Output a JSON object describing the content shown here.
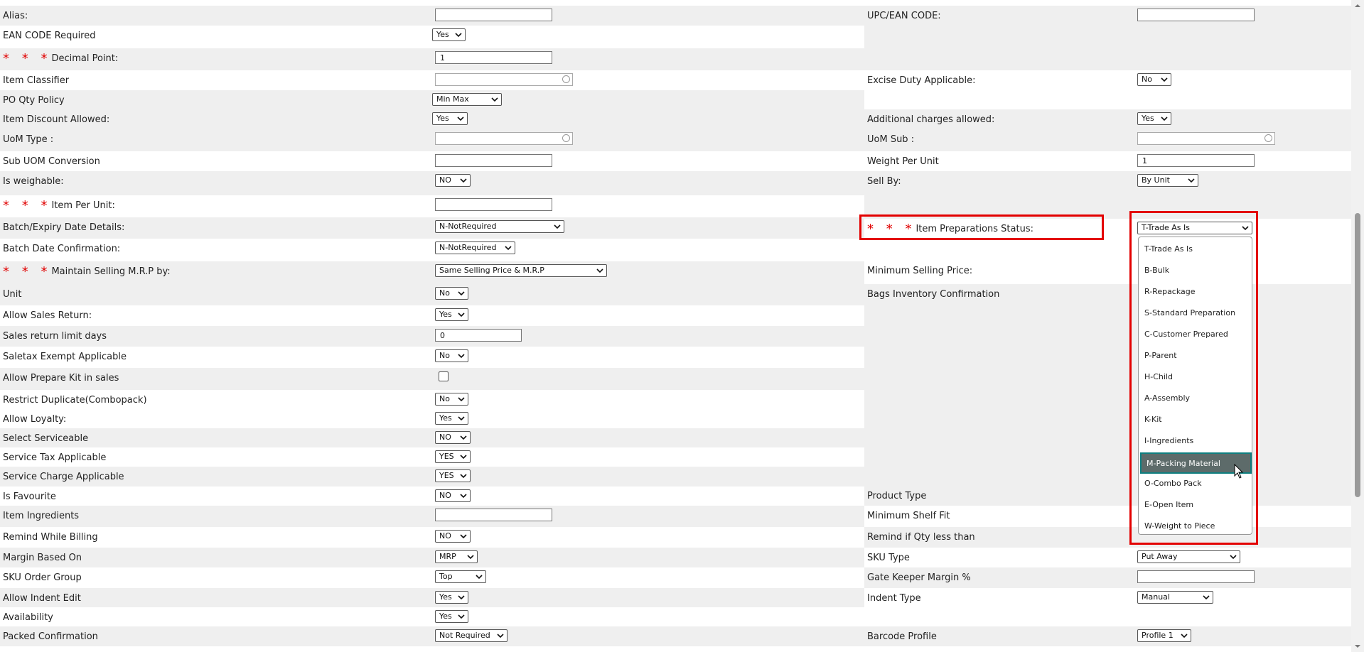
{
  "left_rows": [
    {
      "label": "Alias:",
      "required": false,
      "control": {
        "type": "text",
        "value": ""
      }
    },
    {
      "label": "EAN CODE Required",
      "required": false,
      "control": {
        "type": "select",
        "value": "Yes"
      }
    },
    {
      "label": "Decimal Point:",
      "required": true,
      "control": {
        "type": "text",
        "value": "1"
      }
    },
    {
      "label": "Item Classifier",
      "required": false,
      "control": {
        "type": "lookup",
        "value": ""
      }
    },
    {
      "label": "PO Qty Policy",
      "required": false,
      "control": {
        "type": "select",
        "value": "Min Max"
      }
    },
    {
      "label": "Item Discount Allowed:",
      "required": false,
      "control": {
        "type": "select",
        "value": "Yes"
      }
    },
    {
      "label": "UoM Type :",
      "required": false,
      "control": {
        "type": "lookup",
        "value": ""
      }
    },
    {
      "label": "Sub UOM Conversion",
      "required": false,
      "control": {
        "type": "text",
        "value": ""
      }
    },
    {
      "label": "Is weighable:",
      "required": false,
      "control": {
        "type": "select",
        "value": "NO"
      }
    },
    {
      "label": "Item Per Unit:",
      "required": true,
      "control": {
        "type": "text",
        "value": ""
      }
    },
    {
      "label": "Batch/Expiry Date Details:",
      "required": false,
      "control": {
        "type": "select",
        "value": "N-NotRequired"
      }
    },
    {
      "label": "Batch Date Confirmation:",
      "required": false,
      "control": {
        "type": "select",
        "value": "N-NotRequired"
      }
    },
    {
      "label": "Maintain Selling M.R.P by:",
      "required": true,
      "control": {
        "type": "select",
        "value": "Same Selling Price & M.R.P"
      }
    },
    {
      "label": "Unit",
      "required": false,
      "control": {
        "type": "select",
        "value": "No"
      }
    },
    {
      "label": "Allow Sales Return:",
      "required": false,
      "control": {
        "type": "select",
        "value": "Yes"
      }
    },
    {
      "label": "Sales return limit days",
      "required": false,
      "control": {
        "type": "text",
        "value": "0"
      }
    },
    {
      "label": "Saletax Exempt Applicable",
      "required": false,
      "control": {
        "type": "select",
        "value": "No"
      }
    },
    {
      "label": "Allow Prepare Kit in sales",
      "required": false,
      "control": {
        "type": "checkbox",
        "value": ""
      }
    },
    {
      "label": "Restrict Duplicate(Combopack)",
      "required": false,
      "control": {
        "type": "select",
        "value": "No"
      }
    },
    {
      "label": "Allow Loyalty:",
      "required": false,
      "control": {
        "type": "select",
        "value": "Yes"
      }
    },
    {
      "label": "Select Serviceable",
      "required": false,
      "control": {
        "type": "select",
        "value": "NO"
      }
    },
    {
      "label": "Service Tax Applicable",
      "required": false,
      "control": {
        "type": "select",
        "value": "YES"
      }
    },
    {
      "label": "Service Charge Applicable",
      "required": false,
      "control": {
        "type": "select",
        "value": "YES"
      }
    },
    {
      "label": "Is Favourite",
      "required": false,
      "control": {
        "type": "select",
        "value": "NO"
      }
    },
    {
      "label": "Item Ingredients",
      "required": false,
      "control": {
        "type": "text",
        "value": ""
      }
    },
    {
      "label": "Remind While Billing",
      "required": false,
      "control": {
        "type": "select",
        "value": "NO"
      }
    },
    {
      "label": "Margin Based On",
      "required": false,
      "control": {
        "type": "select",
        "value": "MRP"
      }
    },
    {
      "label": "SKU Order Group",
      "required": false,
      "control": {
        "type": "select",
        "value": "Top"
      }
    },
    {
      "label": "Allow Indent Edit",
      "required": false,
      "control": {
        "type": "select",
        "value": "Yes"
      }
    },
    {
      "label": "Availability",
      "required": false,
      "control": {
        "type": "select",
        "value": "Yes"
      }
    },
    {
      "label": "Packed Confirmation",
      "required": false,
      "control": {
        "type": "select",
        "value": "Not Required"
      }
    }
  ],
  "right_rows": [
    {
      "label": "UPC/EAN CODE:",
      "required": false,
      "control": {
        "type": "text",
        "value": ""
      }
    },
    {
      "label": "Excise Duty Applicable:",
      "required": false,
      "control": {
        "type": "select",
        "value": "No"
      }
    },
    {
      "label": "Additional charges allowed:",
      "required": false,
      "control": {
        "type": "select",
        "value": "Yes"
      }
    },
    {
      "label": "UoM Sub :",
      "required": false,
      "control": {
        "type": "lookup",
        "value": ""
      }
    },
    {
      "label": "Weight Per Unit",
      "required": false,
      "control": {
        "type": "text",
        "value": "1"
      }
    },
    {
      "label": "Sell By:",
      "required": false,
      "control": {
        "type": "select",
        "value": "By Unit"
      }
    },
    {
      "label": "Item Preparations Status:",
      "required": true,
      "control": {
        "type": "select",
        "value": "T-Trade As Is"
      }
    },
    {
      "label": "Minimum Selling Price:",
      "required": false,
      "control": {
        "type": "none",
        "value": ""
      }
    },
    {
      "label": "Bags Inventory Confirmation",
      "required": false,
      "control": {
        "type": "none",
        "value": ""
      }
    },
    {
      "label": "Product Type",
      "required": false,
      "control": {
        "type": "none",
        "value": ""
      }
    },
    {
      "label": "Minimum Shelf Fit",
      "required": false,
      "control": {
        "type": "none",
        "value": ""
      }
    },
    {
      "label": "Remind if Qty less than",
      "required": false,
      "control": {
        "type": "none",
        "value": ""
      }
    },
    {
      "label": "SKU Type",
      "required": false,
      "control": {
        "type": "select",
        "value": "Put Away"
      }
    },
    {
      "label": "Gate Keeper Margin %",
      "required": false,
      "control": {
        "type": "text",
        "value": ""
      }
    },
    {
      "label": "Indent Type",
      "required": false,
      "control": {
        "type": "select",
        "value": "Manual"
      }
    },
    {
      "label": "Barcode Profile",
      "required": false,
      "control": {
        "type": "select",
        "value": "Profile 1"
      }
    }
  ],
  "required_marker": "* * *",
  "dropdown": {
    "selected": "M-Packing Material",
    "options": [
      "T-Trade As Is",
      "B-Bulk",
      "R-Repackage",
      "S-Standard Preparation",
      "C-Customer Prepared",
      "P-Parent",
      "H-Child",
      "A-Assembly",
      "K-Kit",
      "I-Ingredients",
      "M-Packing Material",
      "O-Combo Pack",
      "E-Open Item",
      "W-Weight to Piece"
    ]
  },
  "colors": {
    "highlight": "#e30000",
    "required": "#e00000",
    "option_selected_bg": "#5d6b6a",
    "option_selected_border": "#0f7f80",
    "row_alt": "#efefef"
  },
  "icons": [
    "chevron-down-icon",
    "lookup-circle-icon",
    "mouse-pointer-icon"
  ]
}
